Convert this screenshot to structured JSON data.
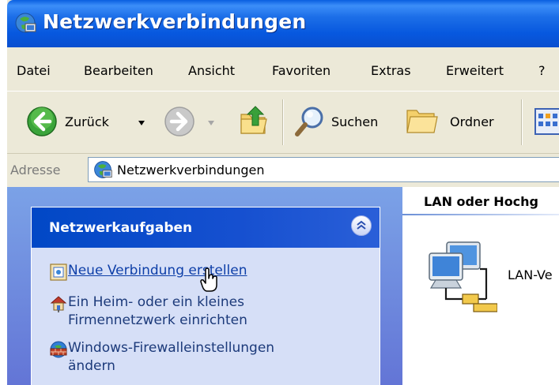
{
  "window": {
    "title": "Netzwerkverbindungen"
  },
  "menu": [
    "Datei",
    "Bearbeiten",
    "Ansicht",
    "Favoriten",
    "Extras",
    "Erweitert",
    "?"
  ],
  "toolbar": {
    "back_label": "Zurück",
    "search_label": "Suchen",
    "folders_label": "Ordner"
  },
  "address": {
    "label": "Adresse",
    "value": "Netzwerkverbindungen"
  },
  "taskpane": {
    "title": "Netzwerkaufgaben",
    "tasks": [
      {
        "line1": "Neue Verbindung erstellen",
        "icon": "new-connection-icon"
      },
      {
        "line1": "Ein Heim- oder ein kleines",
        "line2": "Firmennetzwerk einrichten",
        "icon": "home-network-icon"
      },
      {
        "line1": "Windows-Firewalleinstellungen",
        "line2": "ändern",
        "icon": "firewall-icon"
      }
    ]
  },
  "content": {
    "group_header": "LAN oder Hochg",
    "item_label": "LAN-Ve"
  },
  "colors": {
    "title_bar": "#0a5fe0",
    "task_pane": "#7ba2e7",
    "link": "#0e3fa8"
  }
}
